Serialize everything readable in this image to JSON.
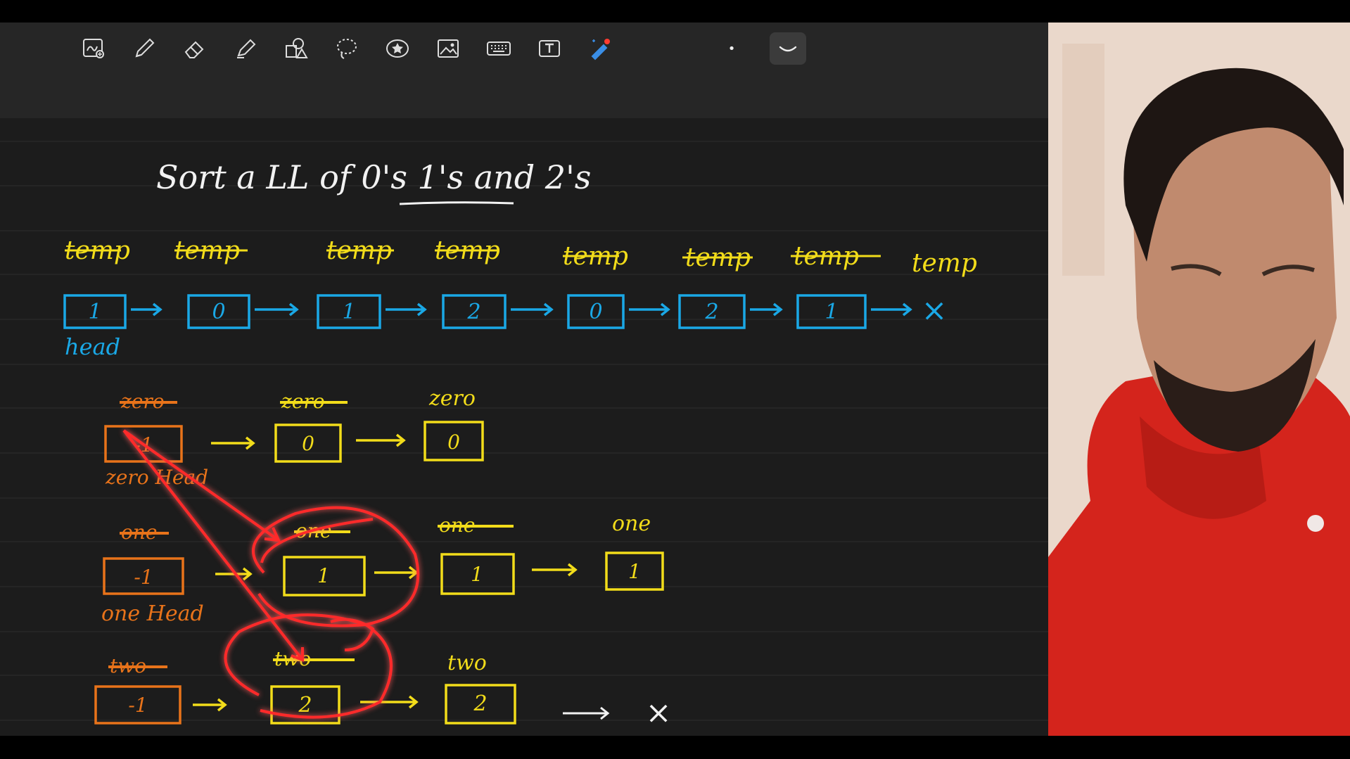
{
  "toolbar": {
    "tools": [
      {
        "name": "image-insert-icon"
      },
      {
        "name": "pen-icon"
      },
      {
        "name": "eraser-icon"
      },
      {
        "name": "highlighter-icon"
      },
      {
        "name": "shapes-icon"
      },
      {
        "name": "lasso-icon"
      },
      {
        "name": "sticker-icon"
      },
      {
        "name": "photo-icon"
      },
      {
        "name": "keyboard-icon"
      },
      {
        "name": "text-box-icon"
      },
      {
        "name": "laser-pointer-icon"
      }
    ],
    "stroke_dot": "•",
    "active_tool": "curve-icon"
  },
  "note": {
    "title": "Sort a LL of 0's 1's and 2's",
    "temp_label": "temp",
    "head_label": "head",
    "null_mark": "×",
    "main_list": [
      "1",
      "0",
      "1",
      "2",
      "0",
      "2",
      "1"
    ],
    "zero_label": "zero",
    "zero_head_label": "zero Head",
    "zero_list": [
      "-1",
      "0",
      "0"
    ],
    "one_label": "one",
    "one_head_label": "one Head",
    "one_list": [
      "-1",
      "1",
      "1",
      "1"
    ],
    "two_label": "two",
    "two_list": [
      "-1",
      "2",
      "2"
    ]
  },
  "colors": {
    "toolbar_bg": "#262626",
    "canvas_bg": "#1c1c1c",
    "ink_white": "#f2f2f2",
    "ink_blue": "#1aa8e6",
    "ink_yellow": "#f2dc1a",
    "ink_orange": "#e8731a",
    "ink_red": "#ff2a2a",
    "hoodie_red": "#d4241c"
  }
}
